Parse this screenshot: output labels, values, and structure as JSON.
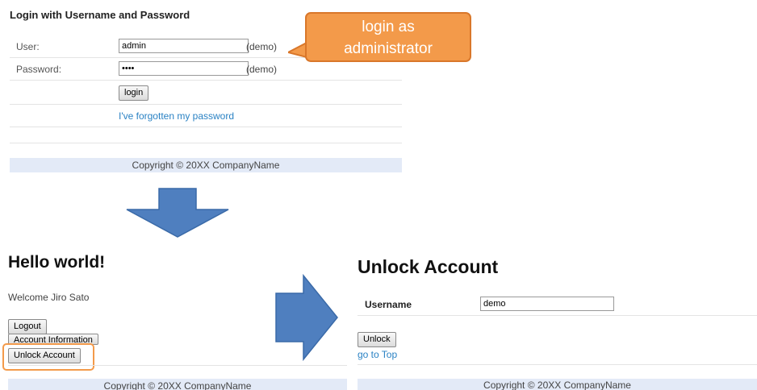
{
  "login": {
    "title": "Login with Username and Password",
    "user_label": "User:",
    "user_value": "admin",
    "user_hint": "(demo)",
    "password_label": "Password:",
    "password_value": "••••",
    "password_hint": "(demo)",
    "login_button": "login",
    "forgot_link": "I've forgotten my password",
    "footer": "Copyright © 20XX CompanyName"
  },
  "callout": {
    "line1": "login as",
    "line2": "administrator",
    "fill_color": "#f39a4a"
  },
  "arrows": {
    "color": "#4f7fbf",
    "down_icon": "arrow-down-icon",
    "right_icon": "arrow-right-icon"
  },
  "home": {
    "title": "Hello world!",
    "welcome": "Welcome Jiro Sato",
    "logout_button": "Logout",
    "account_info_button": "Account Information",
    "unlock_button": "Unlock Account",
    "footer": "Copyright © 20XX CompanyName"
  },
  "unlock": {
    "title": "Unlock Account",
    "username_label": "Username",
    "username_value": "demo",
    "unlock_button": "Unlock",
    "top_link": "go to Top",
    "footer": "Copyright © 20XX CompanyName"
  }
}
